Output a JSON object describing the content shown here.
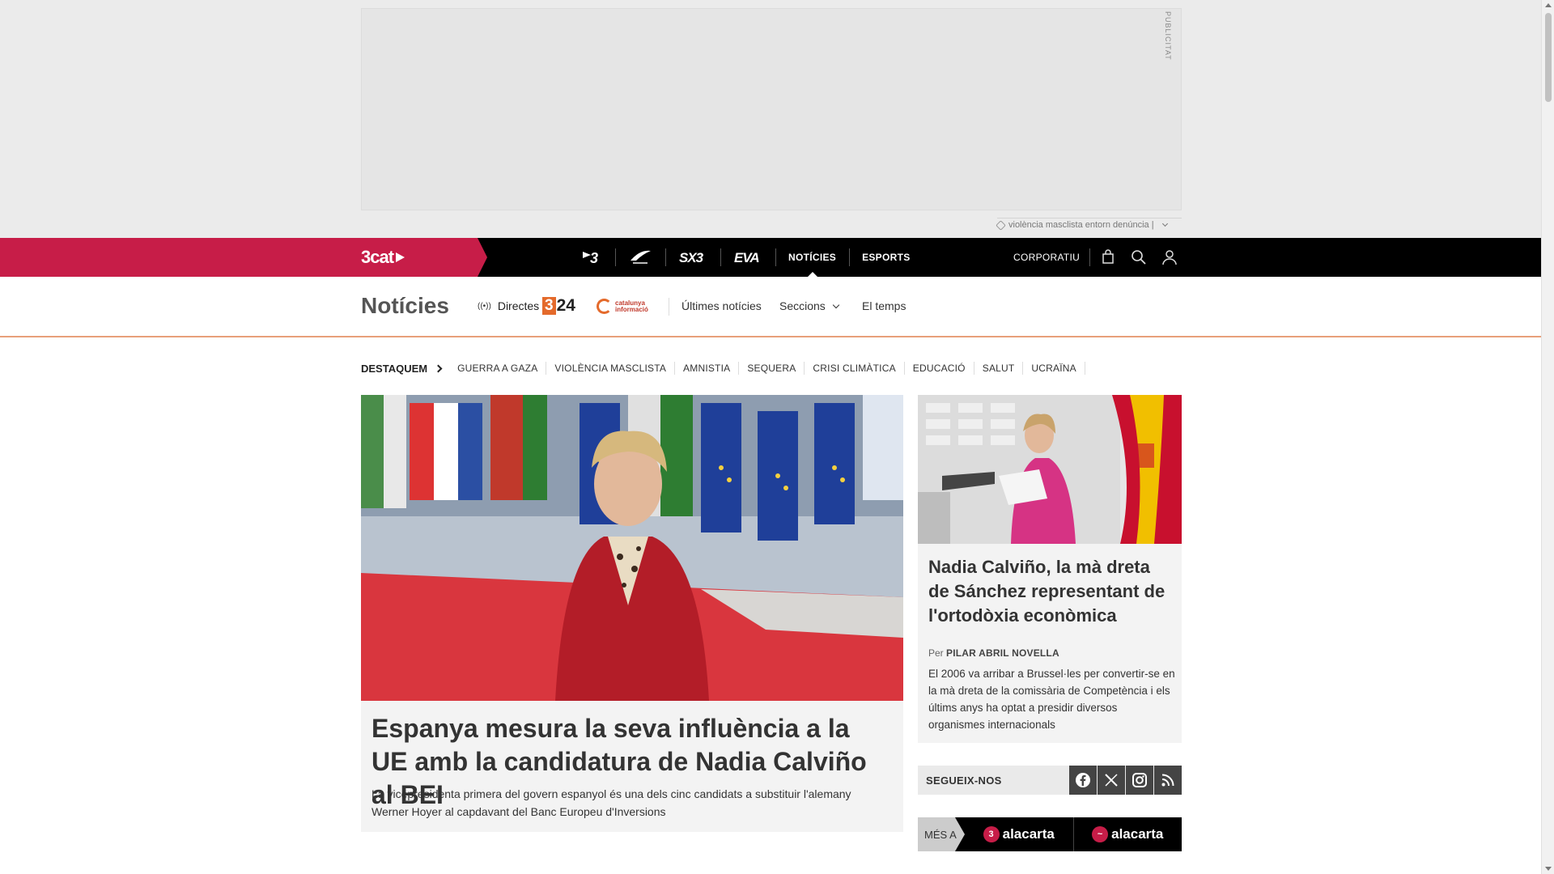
{
  "ad": {
    "label": "PUBLICITAT",
    "report_text": "violència masclista entorn denúncia |"
  },
  "topbar": {
    "brand": "3cat",
    "channels": [
      {
        "label": "3",
        "icon": "tv3-logo"
      },
      {
        "label": "Cat Ràdio",
        "icon": "catradio-logo"
      },
      {
        "label": "SX3",
        "icon": "sx3-logo"
      },
      {
        "label": "EVA",
        "icon": "eva-logo"
      },
      {
        "label": "NOTÍCIES"
      },
      {
        "label": "ESPORTS"
      }
    ],
    "corporate": "CORPORATIU",
    "icons": [
      "shopping-bag-icon",
      "search-icon",
      "user-icon"
    ]
  },
  "section": {
    "title": "Notícies",
    "directes": "Directes",
    "logo_324": "24",
    "logo_324_box": "3",
    "logo_catinfo_line1": "catalunya",
    "logo_catinfo_line2": "informació",
    "nav": [
      "Últimes notícies",
      "Seccions",
      "El temps"
    ]
  },
  "highlights": {
    "title": "DESTAQUEM",
    "items": [
      "GUERRA A GAZA",
      "VIOLÈNCIA MASCLISTA",
      "AMNISTIA",
      "SEQUERA",
      "CRISI CLIMÀTICA",
      "EDUCACIÓ",
      "SALUT",
      "UCRAÏNA"
    ]
  },
  "main_article": {
    "title": "Espanya mesura la seva influència a la UE amb la candidatura de Nadia Calviño al BEI",
    "lead": "La vicepresidenta primera del govern espanyol és una dels cinc candidats a substituir l'alemany Werner Hoyer al capdavant del Banc Europeu d'Inversions"
  },
  "side_article": {
    "title": "Nadia Calviño, la mà dreta de Sánchez representant de l'ortodòxia econòmica",
    "author_prefix": "Per",
    "author": "PILAR ABRIL NOVELLA",
    "lead": "El 2006 va arribar a Brussel·les per convertir-se en la mà dreta de la comissària de Competència i els últims anys ha optat a presidir diversos organismes internacionals"
  },
  "follow": {
    "label": "SEGUEIX-NOS",
    "networks": [
      "facebook-icon",
      "x-icon",
      "instagram-icon",
      "rss-icon"
    ]
  },
  "alacarta": {
    "more": "MÉS A",
    "items": [
      "alacarta",
      "alacarta"
    ]
  },
  "colors": {
    "brand": "#c71d48",
    "accent_324": "#e46a2b"
  }
}
